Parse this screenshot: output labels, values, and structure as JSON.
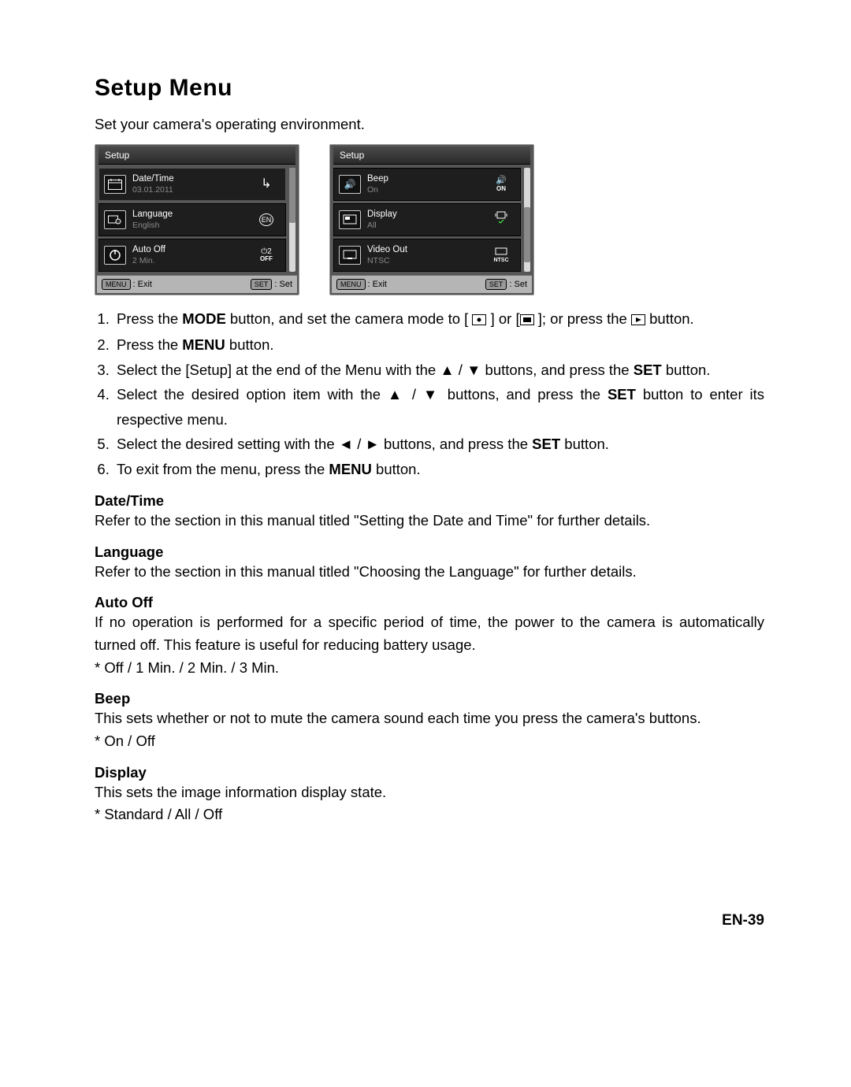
{
  "title": "Setup Menu",
  "subtitle": "Set your camera's operating environment.",
  "screens": {
    "left": {
      "header": "Setup",
      "rows": [
        {
          "label": "Date/Time",
          "value": "03.01.2011",
          "icon": "datetime-icon",
          "rightIcon": "↳"
        },
        {
          "label": "Language",
          "value": "English",
          "icon": "language-icon",
          "rightIcon": "EN"
        },
        {
          "label": "Auto Off",
          "value": "2 Min.",
          "icon": "autooff-icon",
          "right1": "⏻2",
          "right2": "OFF"
        }
      ],
      "footer": {
        "menu": "MENU",
        "exit": ": Exit",
        "set": "SET",
        "setlabel": ": Set"
      }
    },
    "right": {
      "header": "Setup",
      "rows": [
        {
          "label": "Beep",
          "value": "On",
          "icon": "beep-icon",
          "right1": "🔊",
          "right2": "ON"
        },
        {
          "label": "Display",
          "value": "All",
          "icon": "display-icon",
          "right1": "▢",
          "right2": "✓"
        },
        {
          "label": "Video Out",
          "value": "NTSC",
          "icon": "video-icon",
          "right1": "▭",
          "right2": "NTSC"
        }
      ],
      "footer": {
        "menu": "MENU",
        "exit": ": Exit",
        "set": "SET",
        "setlabel": ": Set"
      }
    }
  },
  "steps": [
    {
      "pre": "Press the ",
      "b1": "MODE",
      "mid": " button, and set the camera mode to [ ",
      "icon1": "camera-photo-icon",
      "mid2": " ] or [",
      "icon2": "camera-video-icon",
      "mid3": " ]; or press the ",
      "icon3": "play-icon",
      "post": " button."
    },
    {
      "pre": "Press the ",
      "b1": "MENU",
      "post": " button."
    },
    {
      "pre": "Select the [Setup] at the end of the Menu with the ▲ / ▼ buttons, and press the ",
      "b1": "SET",
      "post": " button."
    },
    {
      "pre": "Select the desired option item with the ▲ / ▼ buttons, and press the ",
      "b1": "SET",
      "post": " button to enter its respective menu."
    },
    {
      "pre": "Select the desired setting with the ◄ / ► buttons, and press the ",
      "b1": "SET",
      "post": " button."
    },
    {
      "pre": "To exit from the menu, press the ",
      "b1": "MENU",
      "post": " button."
    }
  ],
  "sections": {
    "datetime": {
      "title": "Date/Time",
      "body": "Refer to the section in this manual titled \"Setting the Date and Time\" for further details."
    },
    "language": {
      "title": "Language",
      "body": "Refer to the section in this manual titled \"Choosing the Language\" for further details."
    },
    "autooff": {
      "title": "Auto Off",
      "body1": "If no operation is performed for a specific period of time, the power to the camera is automatically turned off. This feature is useful for reducing battery usage.",
      "body2": "* Off / 1 Min. / 2 Min. / 3 Min."
    },
    "beep": {
      "title": "Beep",
      "body1": "This sets whether or not to mute the camera sound each time you press the camera's buttons.",
      "body2": "* On / Off"
    },
    "display": {
      "title": "Display",
      "body1": "This sets the image information display state.",
      "body2": "* Standard / All / Off"
    }
  },
  "pageNumber": "EN-39"
}
